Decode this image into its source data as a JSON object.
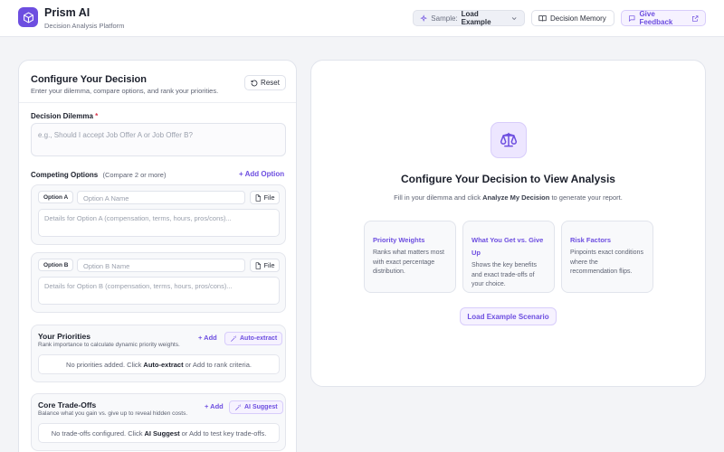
{
  "app": {
    "title": "Prism AI",
    "subtitle": "Decision Analysis Platform"
  },
  "header": {
    "sample_label": "Sample:",
    "sample_value": "Load Example",
    "memory_label": "Decision Memory",
    "feedback_label": "Give Feedback"
  },
  "config": {
    "title": "Configure Your Decision",
    "subtitle": "Enter your dilemma, compare options, and rank your priorities.",
    "reset_label": "Reset",
    "dilemma_label": "Decision Dilemma",
    "dilemma_required": "*",
    "dilemma_placeholder": "e.g., Should I accept Job Offer A or Job Offer B?",
    "options_label": "Competing Options",
    "options_hint": "(Compare 2 or more)",
    "add_option_label": "+ Add Option",
    "options": [
      {
        "tag": "Option A",
        "name_placeholder": "Option A Name",
        "file_label": "File",
        "details_placeholder": "Details for Option A (compensation, terms, hours, pros/cons)..."
      },
      {
        "tag": "Option B",
        "name_placeholder": "Option B Name",
        "file_label": "File",
        "details_placeholder": "Details for Option B (compensation, terms, hours, pros/cons)..."
      }
    ],
    "priorities": {
      "title": "Your Priorities",
      "subtitle": "Rank importance to calculate dynamic priority weights.",
      "add_label": "+ Add",
      "action_label": "Auto-extract",
      "empty_prefix": "No priorities added. Click",
      "empty_action": "Auto-extract",
      "empty_suffix": "or Add to rank criteria."
    },
    "tradeoffs": {
      "title": "Core Trade-Offs",
      "subtitle": "Balance what you gain vs. give up to reveal hidden costs.",
      "add_label": "+ Add",
      "action_label": "AI Suggest",
      "empty_prefix": "No trade-offs configured. Click",
      "empty_action": "AI Suggest",
      "empty_suffix": "or Add to test key trade-offs."
    }
  },
  "analysis": {
    "title": "Configure Your Decision to View Analysis",
    "sub_prefix": "Fill in your dilemma and click",
    "sub_action": "Analyze My Decision",
    "sub_suffix": "to generate your report.",
    "features": [
      {
        "title": "Priority Weights",
        "desc": "Ranks what matters most with exact percentage distribution."
      },
      {
        "title": "What You Get vs. Give Up",
        "desc": "Shows the key benefits and exact trade-offs of your choice."
      },
      {
        "title": "Risk Factors",
        "desc": "Pinpoints exact conditions where the recommendation flips."
      }
    ],
    "load_example_label": "Load Example Scenario"
  },
  "colors": {
    "accent": "#6d4ee0",
    "accent_soft": "#ede6ff",
    "required": "#d9344a"
  }
}
